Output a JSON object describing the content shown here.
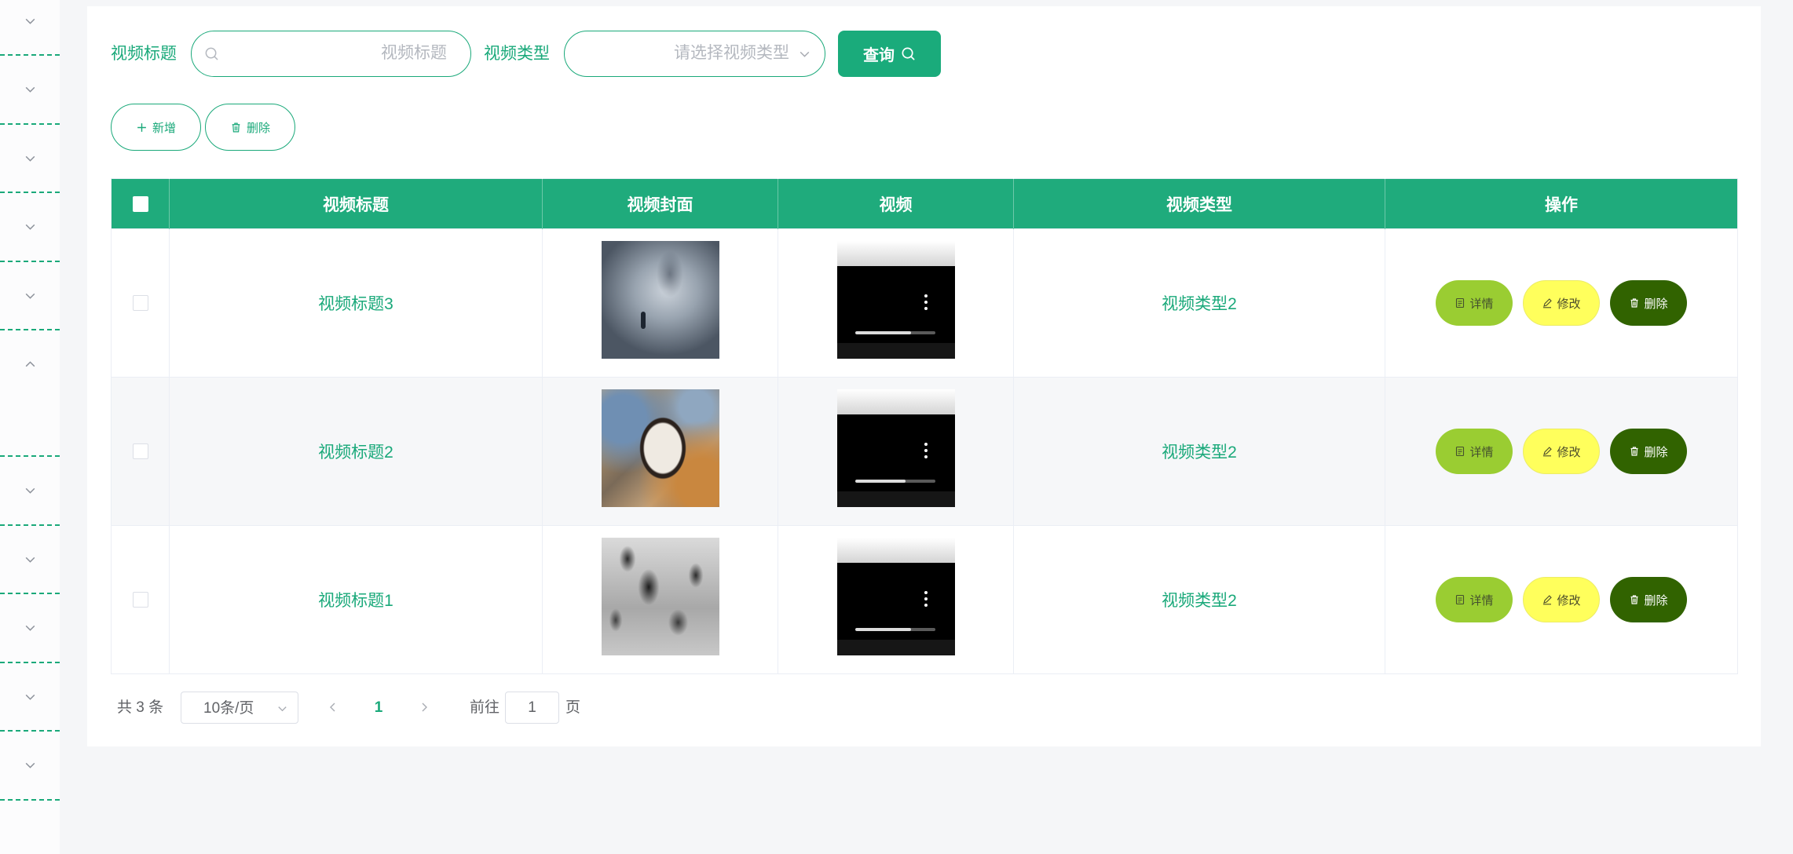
{
  "sidebar": {
    "groups": [
      {
        "expanded": false
      },
      {
        "expanded": false
      },
      {
        "expanded": false
      },
      {
        "expanded": false
      },
      {
        "expanded": false
      },
      {
        "expanded": true
      },
      {
        "expanded": false
      },
      {
        "expanded": false
      },
      {
        "expanded": false
      },
      {
        "expanded": false
      },
      {
        "expanded": false
      }
    ],
    "collapsed_icon": "chevron-down-icon",
    "expanded_icon": "chevron-up-icon"
  },
  "search": {
    "title_label": "视频标题",
    "title_placeholder": "视频标题",
    "type_label": "视频类型",
    "type_placeholder": "请选择视频类型",
    "query_label": "查询"
  },
  "toolbar": {
    "add_label": "新增",
    "delete_label": "删除"
  },
  "table": {
    "columns": [
      "视频标题",
      "视频封面",
      "视频",
      "视频类型",
      "操作"
    ],
    "rows": [
      {
        "title": "视频标题3",
        "type": "视频类型2",
        "video_progress": 0.7
      },
      {
        "title": "视频标题2",
        "type": "视频类型2",
        "video_progress": 0.63
      },
      {
        "title": "视频标题1",
        "type": "视频类型2",
        "video_progress": 0.7
      }
    ],
    "actions": {
      "detail": "详情",
      "edit": "修改",
      "delete": "删除"
    }
  },
  "pagination": {
    "total": "共 3 条",
    "page_size": "10条/页",
    "current_page": "1",
    "goto_label": "前往",
    "goto_value": "1",
    "page_suffix": "页"
  },
  "icons": {
    "search": "search-icon",
    "select": "chevron-down-icon",
    "add": "plus-icon",
    "delete": "trash-icon",
    "detail": "document-icon",
    "edit": "pencil-icon",
    "prev": "chevron-left-icon",
    "next": "chevron-right-icon"
  },
  "colors": {
    "primary": "#1aab7b",
    "header": "#1fab7c",
    "detail_button": "#9acd32",
    "edit_button": "#ffff5c",
    "delete_button": "#316300"
  }
}
